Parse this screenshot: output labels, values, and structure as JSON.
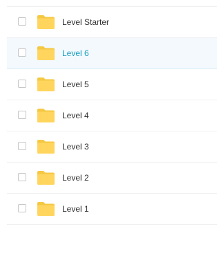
{
  "file_list": {
    "items": [
      {
        "label": "Level Starter",
        "icon": "folder-icon",
        "hovered": false
      },
      {
        "label": "Level 6",
        "icon": "folder-icon",
        "hovered": true
      },
      {
        "label": "Level 5",
        "icon": "folder-icon",
        "hovered": false
      },
      {
        "label": "Level 4",
        "icon": "folder-icon",
        "hovered": false
      },
      {
        "label": "Level 3",
        "icon": "folder-icon",
        "hovered": false
      },
      {
        "label": "Level 2",
        "icon": "folder-icon",
        "hovered": false
      },
      {
        "label": "Level 1",
        "icon": "folder-icon",
        "hovered": false
      }
    ]
  },
  "colors": {
    "folder": "#ffd55e",
    "folder_tab": "#f5c842",
    "hover_text": "#1a9fbf",
    "hover_bg": "#f3f9fd"
  }
}
